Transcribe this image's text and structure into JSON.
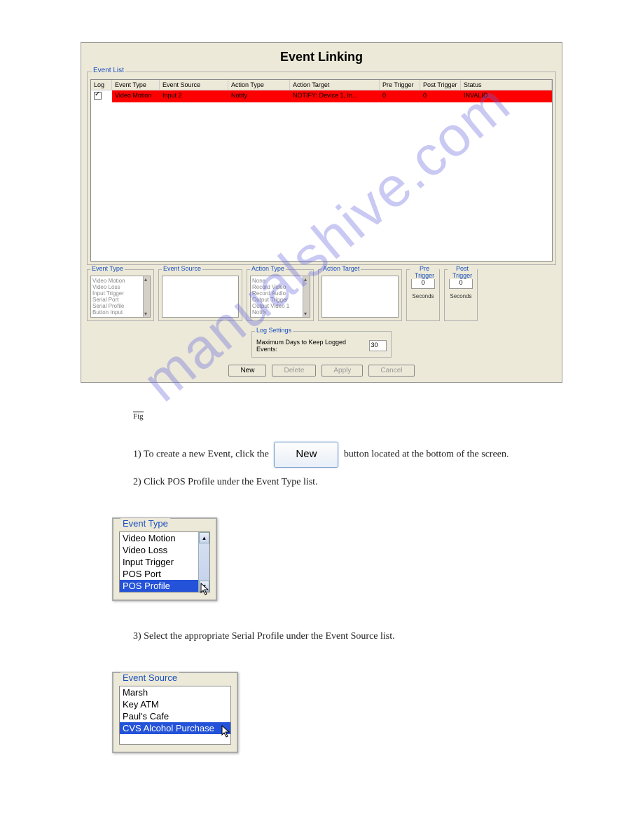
{
  "dialog": {
    "title": "Event Linking",
    "eventList": {
      "label": "Event List",
      "headers": {
        "log": "Log",
        "eventType": "Event Type",
        "eventSource": "Event Source",
        "actionType": "Action Type",
        "actionTarget": "Action Target",
        "preTrigger": "Pre Trigger",
        "postTrigger": "Post Trigger",
        "status": "Status"
      },
      "row": {
        "eventType": "Video Motion",
        "eventSource": "Input 2",
        "actionType": "Notify",
        "actionTarget": "NOTIFY: Device 1, In...",
        "preTrigger": "0",
        "postTrigger": "0",
        "status": "INVALID"
      }
    },
    "panels": {
      "eventType": {
        "label": "Event Type",
        "items": [
          "Video Motion",
          "Video Loss",
          "Input Trigger",
          "Serial Port",
          "Serial Profile",
          "Button Input"
        ]
      },
      "eventSource": {
        "label": "Event Source"
      },
      "actionType": {
        "label": "Action Type",
        "items": [
          "None",
          "Record Video",
          "Record Audio",
          "Output Trigger",
          "Output Video 1",
          "Notify"
        ]
      },
      "actionTarget": {
        "label": "Action Target"
      },
      "preTrigger": {
        "label": "Pre Trigger",
        "value": "0",
        "unit": "Seconds"
      },
      "postTrigger": {
        "label": "Post Trigger",
        "value": "0",
        "unit": "Seconds"
      }
    },
    "logSettings": {
      "label": "Log Settings",
      "text": "Maximum Days to Keep Logged Events:",
      "value": "30"
    },
    "buttons": {
      "new": "New",
      "delete": "Delete",
      "apply": "Apply",
      "cancel": "Cancel"
    }
  },
  "doc": {
    "figureLabel": "Fig",
    "step1_prefix": "1) To create a new Event, click the",
    "step1_suffix": "button located at the bottom of the screen.",
    "step2": "2) Click POS Profile under the Event Type list.",
    "step3": "3) Select the appropriate Serial Profile under the Event Source list.",
    "newButtonLabel": "New"
  },
  "eventTypePopup": {
    "label": "Event Type",
    "items": [
      "Video Motion",
      "Video Loss",
      "Input Trigger",
      "POS Port",
      "POS Profile"
    ],
    "selected": "POS Profile"
  },
  "eventSourcePopup": {
    "label": "Event Source",
    "items": [
      "Marsh",
      "Key ATM",
      "Paul's Cafe",
      "CVS Alcohol Purchase"
    ],
    "selected": "CVS Alcohol Purchase"
  }
}
